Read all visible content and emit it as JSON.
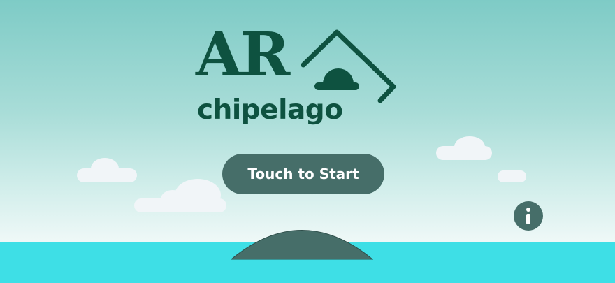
{
  "logo": {
    "title_main": "AR",
    "title_sub": "chipelago",
    "color": "#0e5240"
  },
  "start_button": {
    "label": "Touch to Start",
    "color": "#466e69"
  },
  "info_button": {
    "icon": "info-icon"
  },
  "colors": {
    "sky_top": "#7ecbc6",
    "sky_bottom": "#eef8f7",
    "sea": "#3edfe6",
    "island": "#466e69",
    "cloud": "#f1f5f8"
  }
}
